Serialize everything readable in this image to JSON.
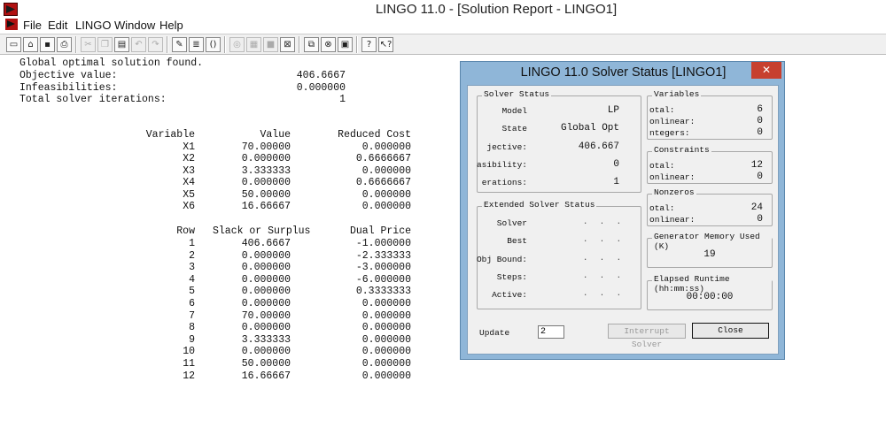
{
  "window": {
    "title": "LINGO 11.0 - [Solution Report - LINGO1]"
  },
  "menu": [
    "File",
    "Edit",
    "LINGO",
    "Window",
    "Help"
  ],
  "toolbar": [
    {
      "icon": "new-file-icon",
      "g": "▭"
    },
    {
      "icon": "open-folder-icon",
      "g": "⌂"
    },
    {
      "icon": "save-icon",
      "g": "▪"
    },
    {
      "icon": "print-icon",
      "g": "⎙"
    },
    {
      "icon": "cut-icon",
      "g": "✂",
      "dis": true
    },
    {
      "icon": "copy-icon",
      "g": "❐",
      "dis": true
    },
    {
      "icon": "paste-icon",
      "g": "▤"
    },
    {
      "icon": "undo-icon",
      "g": "↶",
      "dis": true
    },
    {
      "icon": "redo-icon",
      "g": "↷",
      "dis": true
    },
    {
      "icon": "find-icon",
      "g": "✎"
    },
    {
      "icon": "goto-line-icon",
      "g": "≣"
    },
    {
      "icon": "match-paren-icon",
      "g": "()"
    },
    {
      "icon": "solve-icon",
      "g": "◎",
      "dis": true
    },
    {
      "icon": "solution-icon",
      "g": "▦",
      "dis": true
    },
    {
      "icon": "stop-icon",
      "g": "■",
      "dis": true
    },
    {
      "icon": "close-all-icon",
      "g": "⊠"
    },
    {
      "icon": "send-to-back-icon",
      "g": "⧉"
    },
    {
      "icon": "close-window-icon",
      "g": "⊗"
    },
    {
      "icon": "tile-icon",
      "g": "▣"
    },
    {
      "icon": "help-icon",
      "g": "?"
    },
    {
      "icon": "context-help-icon",
      "g": "↖?"
    }
  ],
  "report": {
    "header": [
      "Global optimal solution found.",
      "Objective value:",
      "Infeasibilities:",
      "Total solver iterations:"
    ],
    "header_values": [
      "",
      "406.6667",
      "0.000000",
      "1"
    ],
    "var_cols": [
      "Variable",
      "Value",
      "Reduced Cost"
    ],
    "vars": [
      [
        "X1",
        "70.00000",
        "0.000000"
      ],
      [
        "X2",
        "0.000000",
        "0.6666667"
      ],
      [
        "X3",
        "3.333333",
        "0.000000"
      ],
      [
        "X4",
        "0.000000",
        "0.6666667"
      ],
      [
        "X5",
        "50.00000",
        "0.000000"
      ],
      [
        "X6",
        "16.66667",
        "0.000000"
      ]
    ],
    "row_cols": [
      "Row",
      "Slack or Surplus",
      "Dual Price"
    ],
    "rows": [
      [
        "1",
        "406.6667",
        "-1.000000"
      ],
      [
        "2",
        "0.000000",
        "-2.333333"
      ],
      [
        "3",
        "0.000000",
        "-3.000000"
      ],
      [
        "4",
        "0.000000",
        "-6.000000"
      ],
      [
        "5",
        "0.000000",
        "0.3333333"
      ],
      [
        "6",
        "0.000000",
        "0.000000"
      ],
      [
        "7",
        "70.00000",
        "0.000000"
      ],
      [
        "8",
        "0.000000",
        "0.000000"
      ],
      [
        "9",
        "3.333333",
        "0.000000"
      ],
      [
        "10",
        "0.000000",
        "0.000000"
      ],
      [
        "11",
        "50.00000",
        "0.000000"
      ],
      [
        "12",
        "16.66667",
        "0.000000"
      ]
    ]
  },
  "dialog": {
    "title": "LINGO 11.0 Solver Status [LINGO1]",
    "close_x": "✕",
    "solver_status": {
      "label": "Solver Status",
      "items": [
        {
          "label": "Model",
          "value": "LP"
        },
        {
          "label": "State",
          "value": "Global Opt"
        },
        {
          "label": "jective:",
          "value": "406.667"
        },
        {
          "label": "asibility:",
          "value": "0"
        },
        {
          "label": "erations:",
          "value": "1"
        }
      ]
    },
    "extended": {
      "label": "Extended Solver Status",
      "items": [
        {
          "label": "Solver",
          "value": ". . ."
        },
        {
          "label": "Best",
          "value": ". . ."
        },
        {
          "label": "Obj Bound:",
          "value": ". . ."
        },
        {
          "label": "Steps:",
          "value": ". . ."
        },
        {
          "label": "Active:",
          "value": ". . ."
        }
      ]
    },
    "variables": {
      "label": "Variables",
      "items": [
        {
          "label": "otal:",
          "value": "6"
        },
        {
          "label": "onlinear:",
          "value": "0"
        },
        {
          "label": "ntegers:",
          "value": "0"
        }
      ]
    },
    "constraints": {
      "label": "Constraints",
      "items": [
        {
          "label": "otal:",
          "value": "12"
        },
        {
          "label": "onlinear:",
          "value": "0"
        }
      ]
    },
    "nonzeros": {
      "label": "Nonzeros",
      "items": [
        {
          "label": "otal:",
          "value": "24"
        },
        {
          "label": "onlinear:",
          "value": "0"
        }
      ]
    },
    "memory": {
      "label": "Generator Memory Used (K)",
      "value": "19"
    },
    "runtime": {
      "label": "Elapsed Runtime (hh:mm:ss)",
      "value": "00:00:00"
    },
    "update_label": "Update",
    "update_value": "2",
    "interrupt_label": "Interrupt Solver",
    "close_label": "Close"
  }
}
